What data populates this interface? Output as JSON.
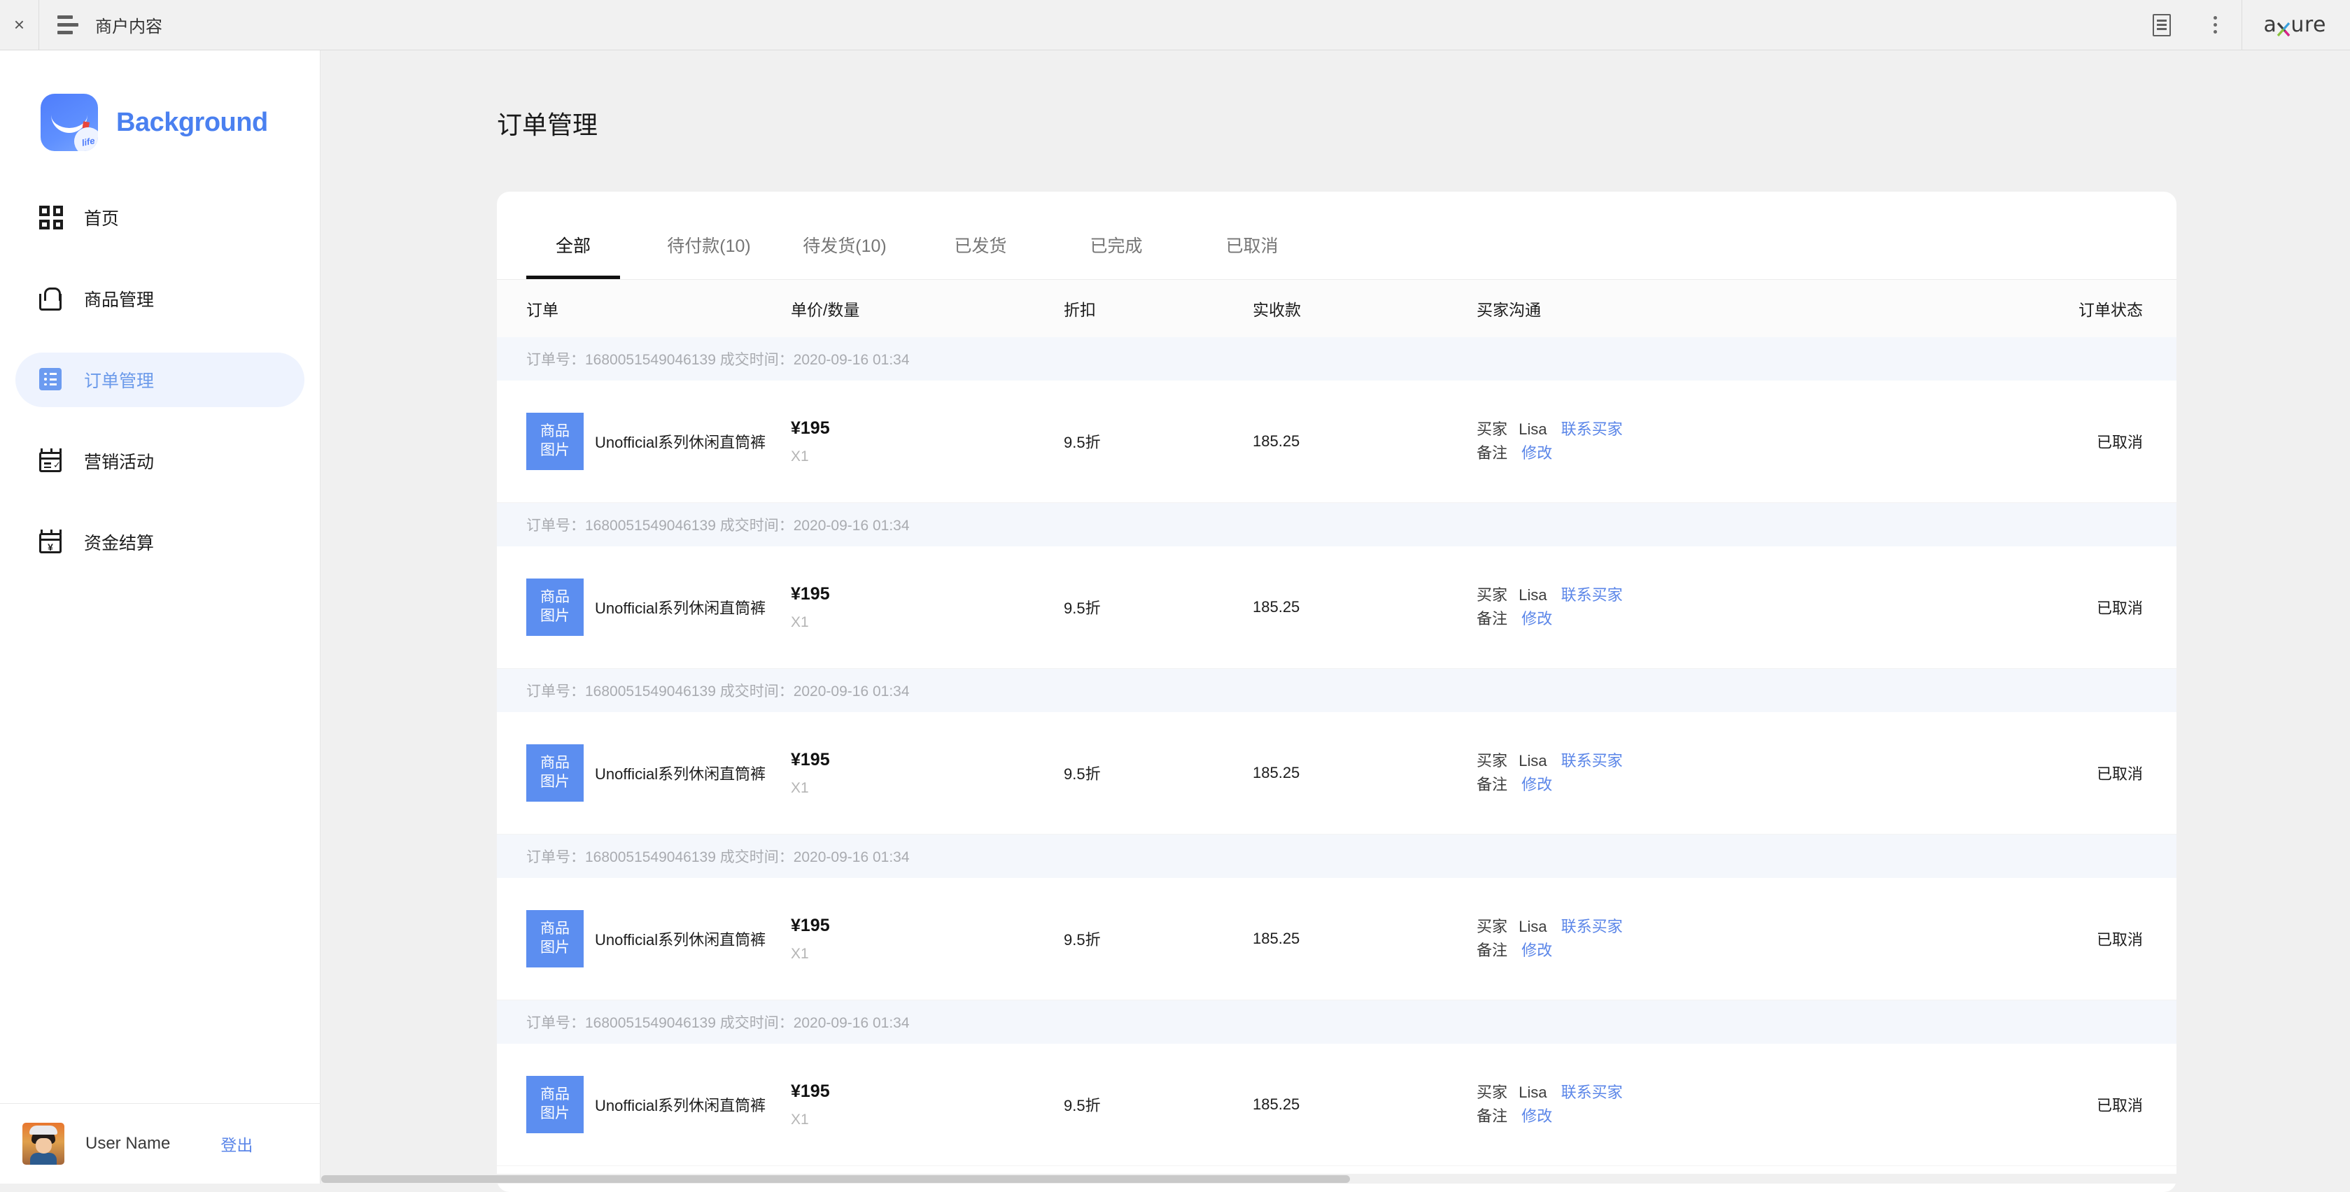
{
  "topbar": {
    "close_label": "×",
    "title": "商户内容",
    "brand": "axure",
    "brand_a": "a",
    "brand_ure": "ure",
    "icons": {
      "menu": "hamburger-icon",
      "doc": "document-icon",
      "more": "more-vertical-icon"
    }
  },
  "sidebar": {
    "brand_name": "Background",
    "brand_badge": "life",
    "items": [
      {
        "label": "首页",
        "icon": "grid-icon",
        "active": false
      },
      {
        "label": "商品管理",
        "icon": "bag-icon",
        "active": false
      },
      {
        "label": "订单管理",
        "icon": "list-icon",
        "active": true
      },
      {
        "label": "营销活动",
        "icon": "calendar-check-icon",
        "active": false
      },
      {
        "label": "资金结算",
        "icon": "calendar-yen-icon",
        "active": false
      }
    ],
    "user": {
      "name": "User Name",
      "logout_label": "登出",
      "avatar": "user-avatar"
    }
  },
  "main": {
    "page_title": "订单管理",
    "tabs": [
      {
        "label": "全部",
        "active": true
      },
      {
        "label": "待付款(10)",
        "active": false
      },
      {
        "label": "待发货(10)",
        "active": false
      },
      {
        "label": "已发货",
        "active": false
      },
      {
        "label": "已完成",
        "active": false
      },
      {
        "label": "已取消",
        "active": false
      }
    ],
    "table": {
      "columns": [
        "订单",
        "单价/数量",
        "折扣",
        "实收款",
        "买家沟通",
        "订单状态"
      ],
      "groups": [
        {
          "meta": "订单号：1680051549046139 成交时间：2020-09-16 01:34",
          "row": {
            "thumb_line1": "商品",
            "thumb_line2": "图片",
            "product": "Unofficial系列休闲直筒裤",
            "price": "¥195",
            "qty": "X1",
            "discount": "9.5折",
            "paid": "185.25",
            "buyer_label": "买家",
            "buyer_name": "Lisa",
            "buyer_link": "联系买家",
            "note_label": "备注",
            "note_link": "修改",
            "status": "已取消"
          }
        },
        {
          "meta": "订单号：1680051549046139 成交时间：2020-09-16 01:34",
          "row": {
            "thumb_line1": "商品",
            "thumb_line2": "图片",
            "product": "Unofficial系列休闲直筒裤",
            "price": "¥195",
            "qty": "X1",
            "discount": "9.5折",
            "paid": "185.25",
            "buyer_label": "买家",
            "buyer_name": "Lisa",
            "buyer_link": "联系买家",
            "note_label": "备注",
            "note_link": "修改",
            "status": "已取消"
          }
        },
        {
          "meta": "订单号：1680051549046139 成交时间：2020-09-16 01:34",
          "row": {
            "thumb_line1": "商品",
            "thumb_line2": "图片",
            "product": "Unofficial系列休闲直筒裤",
            "price": "¥195",
            "qty": "X1",
            "discount": "9.5折",
            "paid": "185.25",
            "buyer_label": "买家",
            "buyer_name": "Lisa",
            "buyer_link": "联系买家",
            "note_label": "备注",
            "note_link": "修改",
            "status": "已取消"
          }
        },
        {
          "meta": "订单号：1680051549046139 成交时间：2020-09-16 01:34",
          "row": {
            "thumb_line1": "商品",
            "thumb_line2": "图片",
            "product": "Unofficial系列休闲直筒裤",
            "price": "¥195",
            "qty": "X1",
            "discount": "9.5折",
            "paid": "185.25",
            "buyer_label": "买家",
            "buyer_name": "Lisa",
            "buyer_link": "联系买家",
            "note_label": "备注",
            "note_link": "修改",
            "status": "已取消"
          }
        },
        {
          "meta": "订单号：1680051549046139 成交时间：2020-09-16 01:34",
          "row": {
            "thumb_line1": "商品",
            "thumb_line2": "图片",
            "product": "Unofficial系列休闲直筒裤",
            "price": "¥195",
            "qty": "X1",
            "discount": "9.5折",
            "paid": "185.25",
            "buyer_label": "买家",
            "buyer_name": "Lisa",
            "buyer_link": "联系买家",
            "note_label": "备注",
            "note_link": "修改",
            "status": "已取消"
          }
        }
      ]
    }
  },
  "colors": {
    "accent": "#5b86e8",
    "brand_blue": "#4a80f0",
    "thumb_blue": "#5c8ef0",
    "active_pill": "#eef3fe",
    "meta_row": "#f4f7fc"
  }
}
